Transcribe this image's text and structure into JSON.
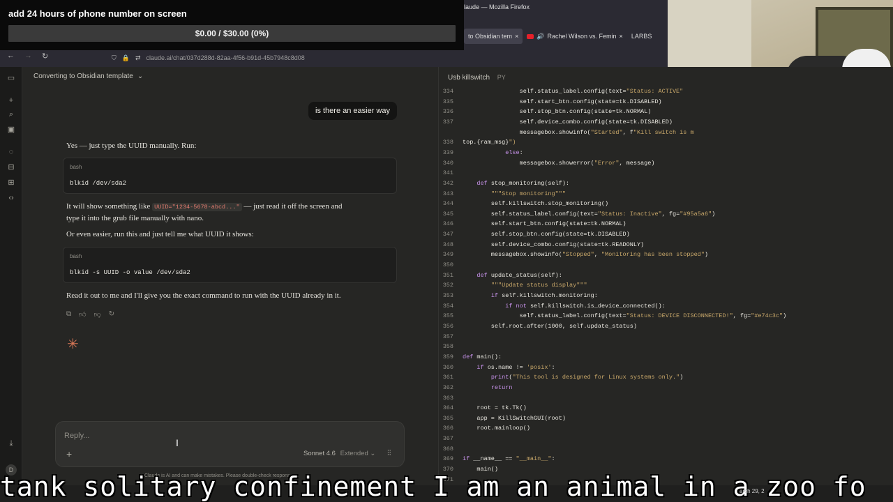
{
  "overlay": {
    "title": "add 24 hours of phone number on screen",
    "progress_text": "$0.00 / $30.00 (0%)",
    "progress": 0
  },
  "firefox": {
    "window_title": "laude — Mozilla Firefox",
    "tabs": [
      {
        "label": "to Obsidian tem",
        "close": "×",
        "active": true
      },
      {
        "label": "Rachel Wilson vs. Femin",
        "close": "×",
        "active": false
      },
      {
        "label": "LARBS",
        "active": false
      }
    ],
    "url": "claude.ai/chat/037d288d-82aa-4f56-b91d-45b7948c8d08"
  },
  "chat": {
    "conversation_title": "Converting to Obsidian template",
    "user_message": "is there an easier way",
    "response_intro": "Yes — just type the UUID manually. Run:",
    "code1_lang": "bash",
    "code1": "blkid /dev/sda2",
    "para2_before": "It will show something like",
    "para2_code": "UUID=\"1234-5678-abcd...\"",
    "para2_after": "— just read it off the screen and",
    "para2_line2": "type it into the grub file manually with nano.",
    "para3": "Or even easier, run this and just tell me what UUID it shows:",
    "code2_lang": "bash",
    "code2": "blkid -s UUID -o value /dev/sda2",
    "para4": "Read it out to me and I'll give you the exact command to run with the UUID already in it.",
    "reply_placeholder": "Reply...",
    "model_label": "Sonnet 4.6",
    "mode_label": "Extended",
    "disclaimer": "Claude is AI and can make mistakes. Please double-check responses."
  },
  "panel": {
    "title": "Usb killswitch",
    "lang": "PY",
    "lines": [
      {
        "n": "334",
        "t": "                self.status_label.config(text=\"Status: ACTIVE\""
      },
      {
        "n": "335",
        "t": "                self.start_btn.config(state=tk.DISABLED)"
      },
      {
        "n": "336",
        "t": "                self.stop_btn.config(state=tk.NORMAL)"
      },
      {
        "n": "337",
        "t": "                self.device_combo.config(state=tk.DISABLED)"
      },
      {
        "n": "",
        "t": "                messagebox.showinfo(\"Started\", f\"Kill switch is m"
      },
      {
        "n": "338",
        "t": "top.{ram_msg}\")"
      },
      {
        "n": "339",
        "t": "            else:"
      },
      {
        "n": "340",
        "t": "                messagebox.showerror(\"Error\", message)"
      },
      {
        "n": "341",
        "t": ""
      },
      {
        "n": "342",
        "t": "    def stop_monitoring(self):"
      },
      {
        "n": "343",
        "t": "        \"\"\"Stop monitoring\"\"\""
      },
      {
        "n": "344",
        "t": "        self.killswitch.stop_monitoring()"
      },
      {
        "n": "345",
        "t": "        self.status_label.config(text=\"Status: Inactive\", fg=\"#95a5a6\")"
      },
      {
        "n": "346",
        "t": "        self.start_btn.config(state=tk.NORMAL)"
      },
      {
        "n": "347",
        "t": "        self.stop_btn.config(state=tk.DISABLED)"
      },
      {
        "n": "348",
        "t": "        self.device_combo.config(state=tk.READONLY)"
      },
      {
        "n": "349",
        "t": "        messagebox.showinfo(\"Stopped\", \"Monitoring has been stopped\")"
      },
      {
        "n": "350",
        "t": ""
      },
      {
        "n": "351",
        "t": "    def update_status(self):"
      },
      {
        "n": "352",
        "t": "        \"\"\"Update status display\"\"\""
      },
      {
        "n": "353",
        "t": "        if self.killswitch.monitoring:"
      },
      {
        "n": "354",
        "t": "            if not self.killswitch.is_device_connected():"
      },
      {
        "n": "355",
        "t": "                self.status_label.config(text=\"Status: DEVICE DISCONNECTED!\", fg=\"#e74c3c\")"
      },
      {
        "n": "356",
        "t": "        self.root.after(1000, self.update_status)"
      },
      {
        "n": "357",
        "t": ""
      },
      {
        "n": "358",
        "t": ""
      },
      {
        "n": "359",
        "t": "def main():"
      },
      {
        "n": "360",
        "t": "    if os.name != 'posix':"
      },
      {
        "n": "361",
        "t": "        print(\"This tool is designed for Linux systems only.\")"
      },
      {
        "n": "362",
        "t": "        return"
      },
      {
        "n": "363",
        "t": ""
      },
      {
        "n": "364",
        "t": "    root = tk.Tk()"
      },
      {
        "n": "365",
        "t": "    app = KillSwitchGUI(root)"
      },
      {
        "n": "366",
        "t": "    root.mainloop()"
      },
      {
        "n": "367",
        "t": ""
      },
      {
        "n": "368",
        "t": ""
      },
      {
        "n": "369",
        "t": "if __name__ == \"__main__\":"
      },
      {
        "n": "370",
        "t": "    main()"
      },
      {
        "n": "371",
        "t": ""
      }
    ]
  },
  "subtitle": "tank solitary confinement I am an animal in a zoo fo",
  "taskbar_date": "arch 29, 2"
}
